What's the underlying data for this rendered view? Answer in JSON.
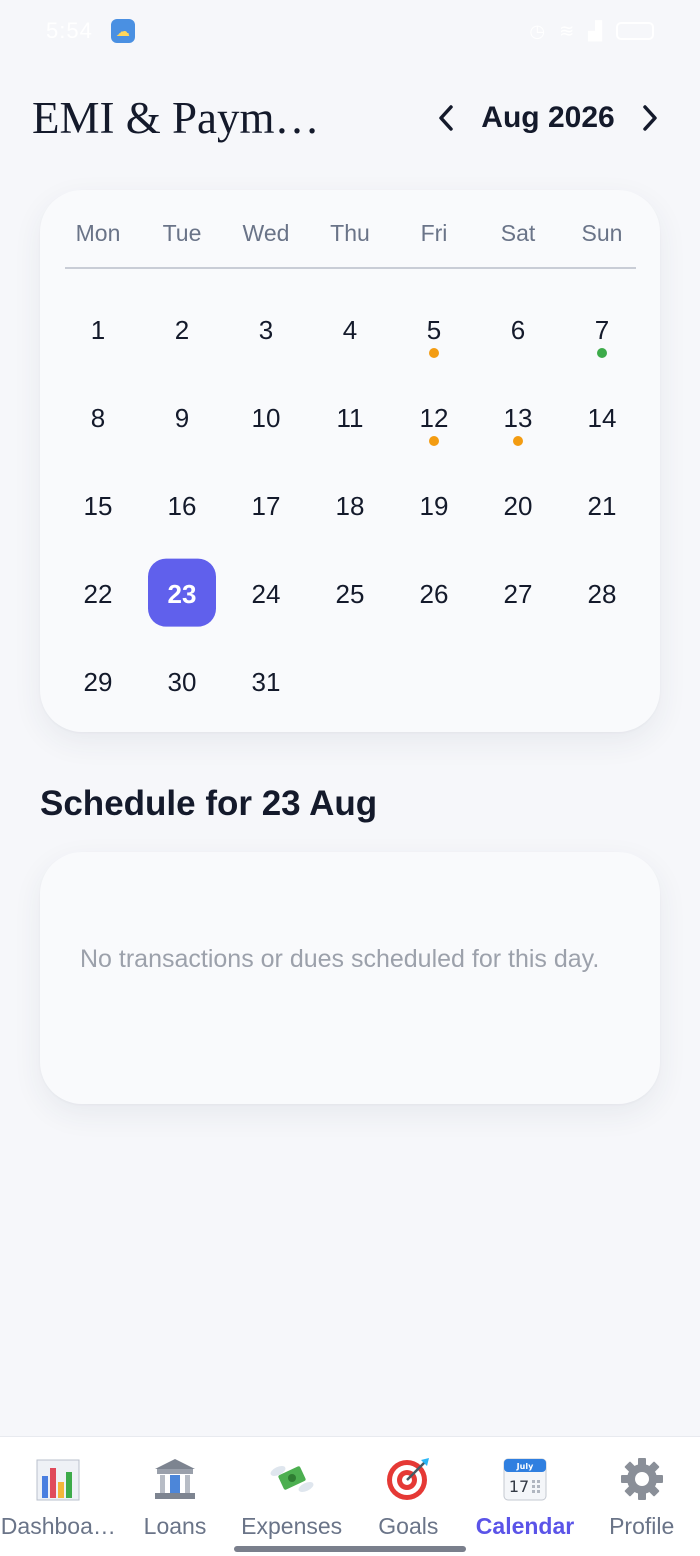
{
  "status_bar": {
    "time": "5:54"
  },
  "header": {
    "title": "EMI & Paym…",
    "month_label": "Aug 2026"
  },
  "calendar": {
    "weekdays": [
      "Mon",
      "Tue",
      "Wed",
      "Thu",
      "Fri",
      "Sat",
      "Sun"
    ],
    "leading_blanks": 0,
    "days_in_month": 31,
    "selected_day": 23,
    "markers": {
      "5": "#f39c12",
      "7": "#3dab4a",
      "12": "#f39c12",
      "13": "#f39c12"
    },
    "accent_color": "#6060ec"
  },
  "schedule": {
    "title": "Schedule for 23 Aug",
    "empty_message": "No transactions or dues scheduled for this day."
  },
  "bottom_nav": {
    "items": [
      {
        "label": "Dashboa…",
        "icon": "bar-chart-icon"
      },
      {
        "label": "Loans",
        "icon": "bank-icon"
      },
      {
        "label": "Expenses",
        "icon": "money-wings-icon"
      },
      {
        "label": "Goals",
        "icon": "target-icon"
      },
      {
        "label": "Calendar",
        "icon": "calendar-icon",
        "active": true,
        "calendar_month": "July",
        "calendar_day": "17"
      },
      {
        "label": "Profile",
        "icon": "gear-icon"
      }
    ]
  }
}
